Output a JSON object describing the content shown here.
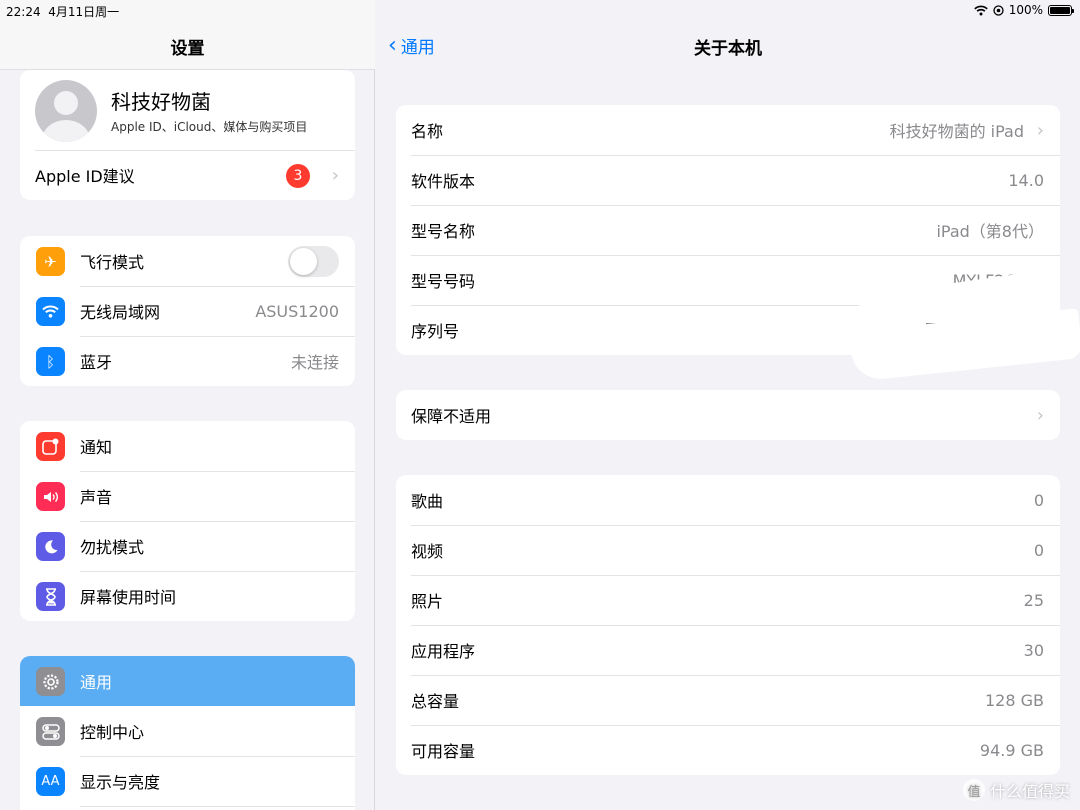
{
  "status": {
    "time": "22:24",
    "date": "4月11日周一",
    "battery": "100%"
  },
  "sidebar": {
    "title": "设置",
    "profile": {
      "name": "科技好物菌",
      "subtitle": "Apple ID、iCloud、媒体与购买项目"
    },
    "apple_id": {
      "label": "Apple ID建议",
      "badge": "3"
    },
    "connectivity": [
      {
        "label": "飞行模式",
        "icon": "airplane-icon",
        "color": "#ff9f0a",
        "glyph": "✈",
        "toggle_on": false
      },
      {
        "label": "无线局域网",
        "icon": "wifi-icon",
        "color": "#0a84ff",
        "glyph": "⌔",
        "value": "ASUS1200"
      },
      {
        "label": "蓝牙",
        "icon": "bluetooth-icon",
        "color": "#0a84ff",
        "glyph": "ᛒ",
        "value": "未连接"
      }
    ],
    "notifications": [
      {
        "label": "通知",
        "icon": "notification-icon",
        "color": "#ff3b30",
        "glyph": "◘"
      },
      {
        "label": "声音",
        "icon": "sound-icon",
        "color": "#ff2d55",
        "glyph": "◀"
      },
      {
        "label": "勿扰模式",
        "icon": "moon-icon",
        "color": "#5e5ce6",
        "glyph": "☾"
      },
      {
        "label": "屏幕使用时间",
        "icon": "hourglass-icon",
        "color": "#5e5ce6",
        "glyph": "⌛"
      }
    ],
    "general": [
      {
        "label": "通用",
        "icon": "gear-icon",
        "color": "#8e8e93",
        "glyph": "⚙",
        "selected": true
      },
      {
        "label": "控制中心",
        "icon": "control-center-icon",
        "color": "#8e8e93",
        "glyph": "◧"
      },
      {
        "label": "显示与亮度",
        "icon": "display-icon",
        "color": "#0a84ff",
        "glyph": "AA"
      }
    ]
  },
  "detail": {
    "back_label": "通用",
    "title": "关于本机",
    "info": [
      {
        "label": "名称",
        "value": "科技好物菌的 iPad",
        "chevron": true
      },
      {
        "label": "软件版本",
        "value": "14.0"
      },
      {
        "label": "型号名称",
        "value": "iPad（第8代）"
      },
      {
        "label": "型号号码",
        "value": "MYLF2CH/A"
      },
      {
        "label": "序列号",
        "value": ""
      }
    ],
    "warranty": {
      "label": "保障不适用"
    },
    "stats": [
      {
        "label": "歌曲",
        "value": "0"
      },
      {
        "label": "视频",
        "value": "0"
      },
      {
        "label": "照片",
        "value": "25"
      },
      {
        "label": "应用程序",
        "value": "30"
      },
      {
        "label": "总容量",
        "value": "128 GB"
      },
      {
        "label": "可用容量",
        "value": "94.9 GB"
      }
    ]
  },
  "watermark": "什么值得买"
}
